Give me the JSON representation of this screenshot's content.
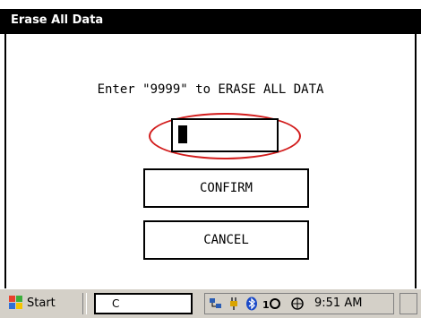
{
  "window": {
    "title": "Erase All Data"
  },
  "dialog": {
    "prompt": "Enter \"9999\" to ERASE ALL DATA",
    "code_value": "",
    "confirm_label": "CONFIRM",
    "cancel_label": "CANCEL"
  },
  "taskbar": {
    "start_label": "Start",
    "task_label": "C",
    "time": "9:51 AM",
    "tray_icons": [
      "network-icon",
      "power-plug-icon",
      "bluetooth-icon",
      "signal-icon",
      "connection-icon"
    ]
  },
  "colors": {
    "titlebar": "#000000",
    "highlight_circle": "#d21c1c",
    "taskbar": "#d4d0c8"
  }
}
